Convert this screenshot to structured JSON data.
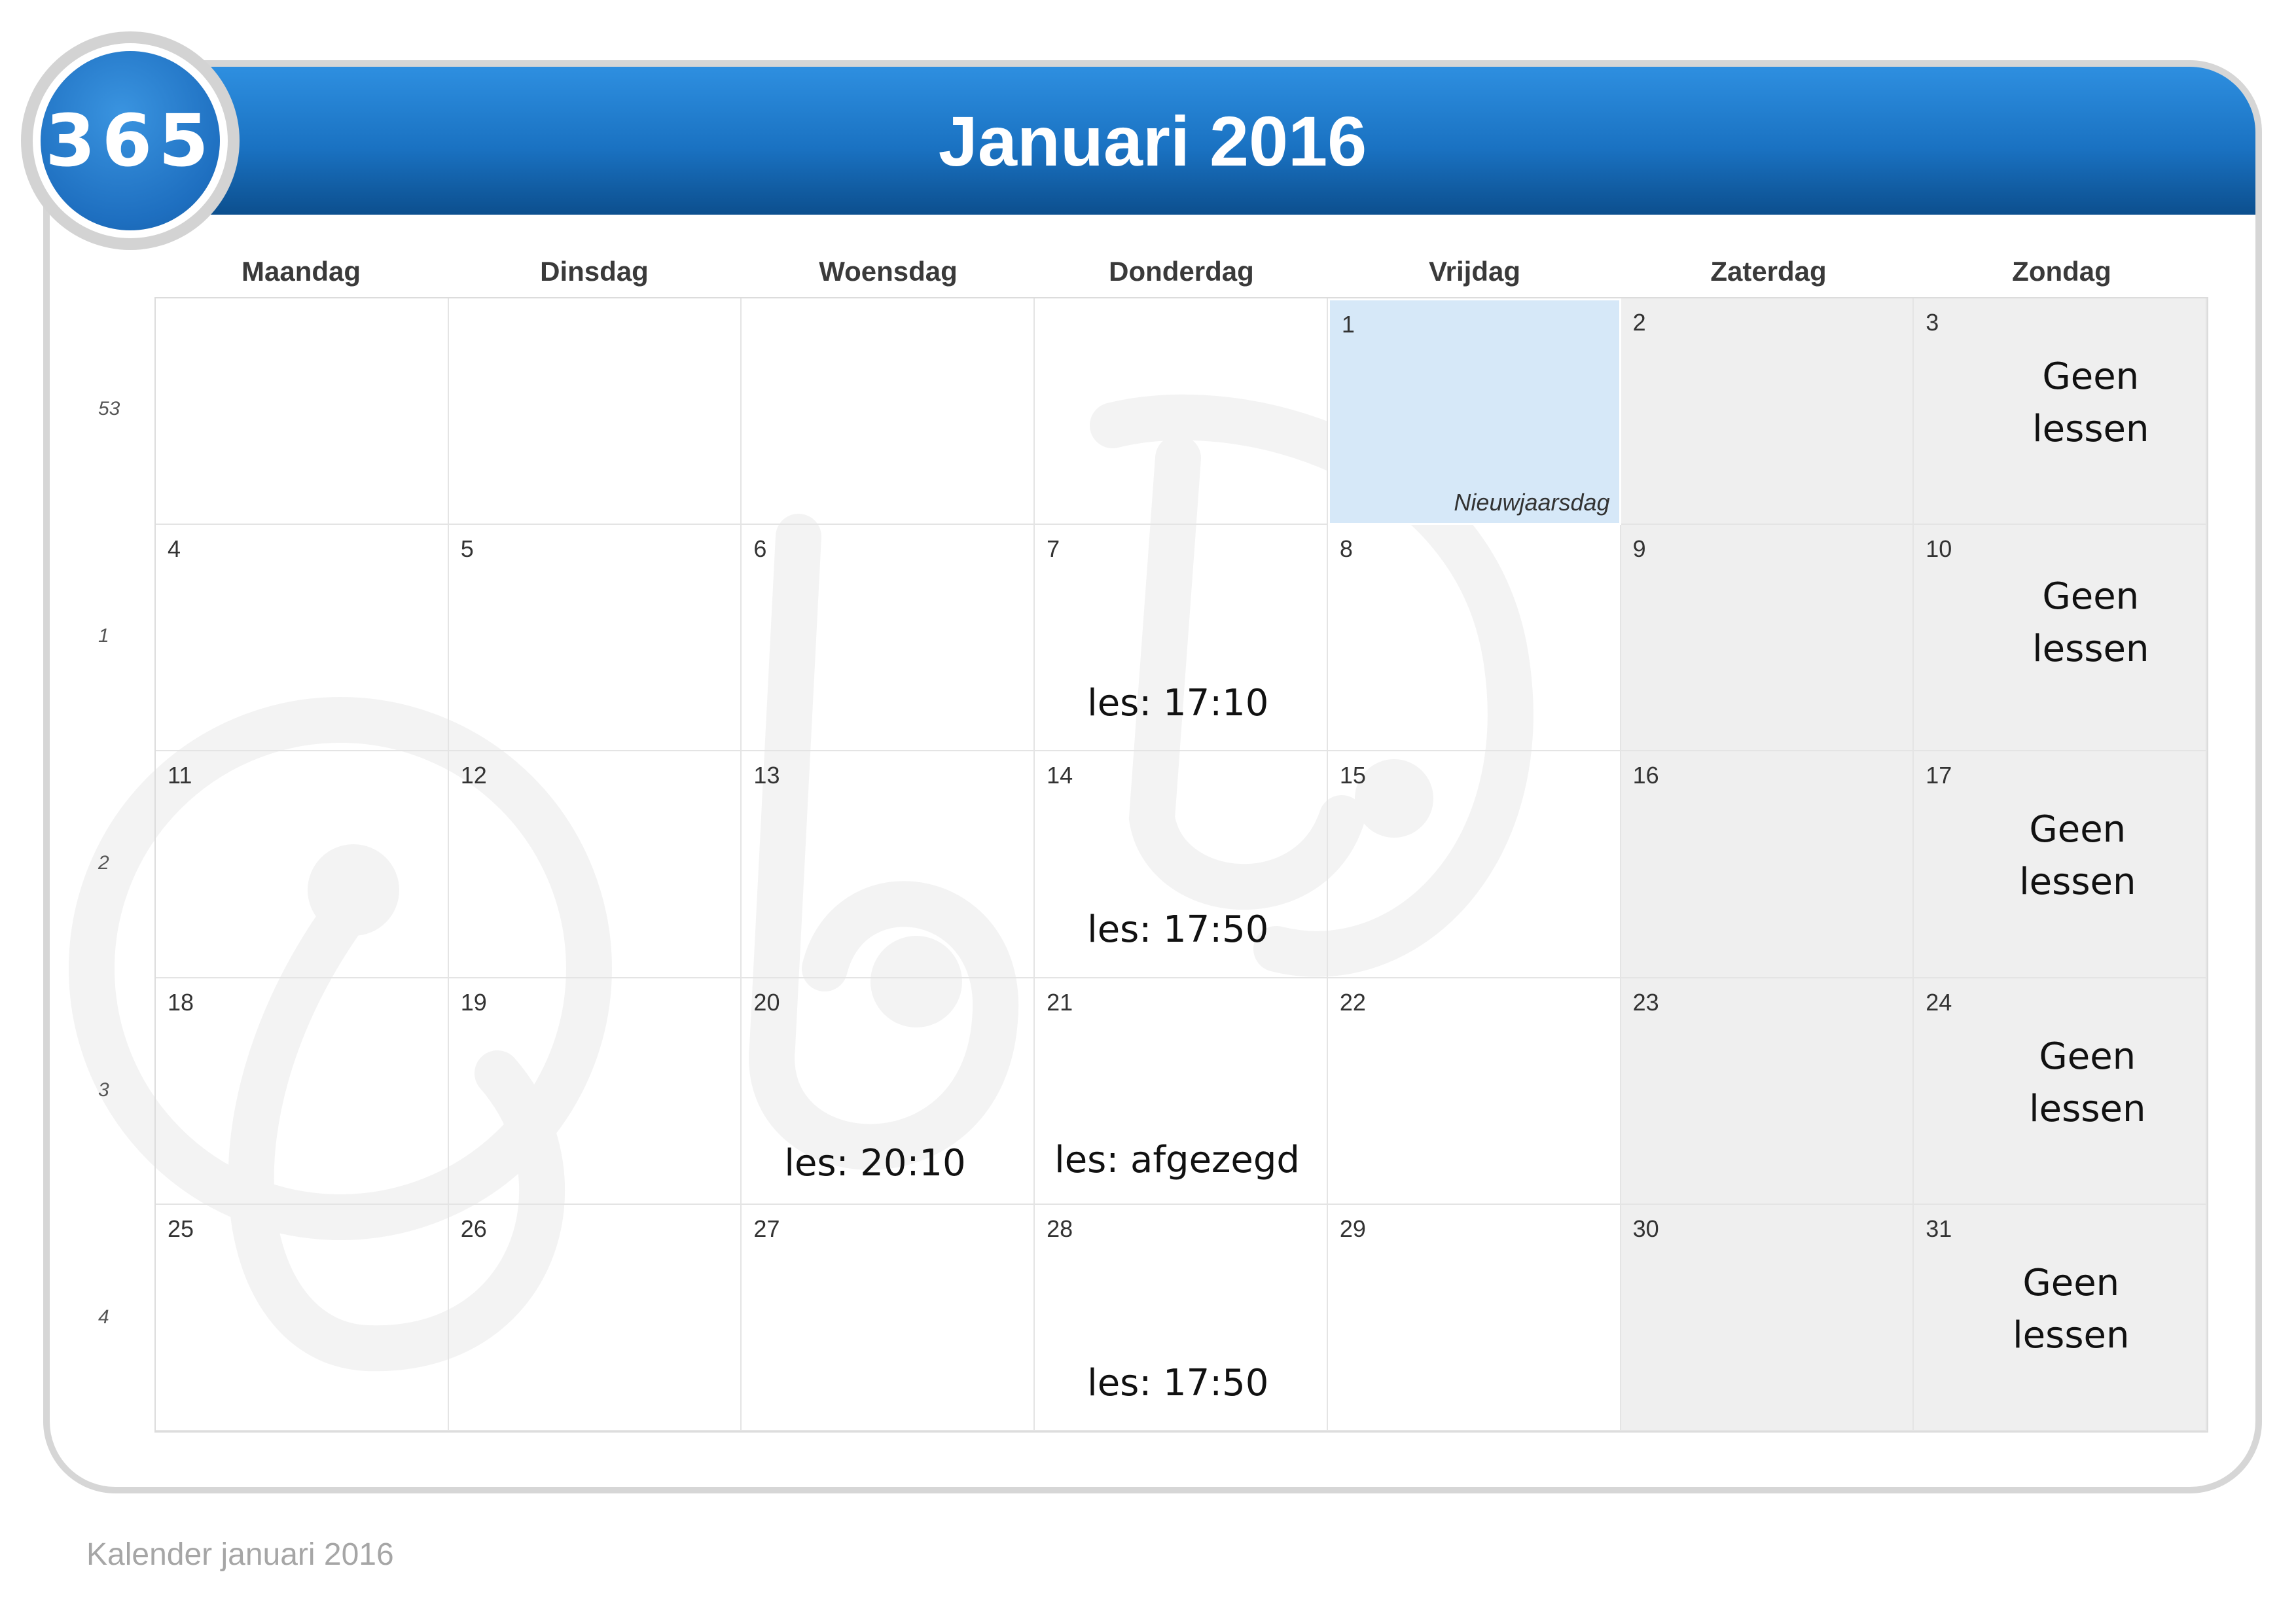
{
  "header": {
    "title": "Januari 2016",
    "logo_text": "365"
  },
  "weekdays": [
    "Maandag",
    "Dinsdag",
    "Woensdag",
    "Donderdag",
    "Vrijdag",
    "Zaterdag",
    "Zondag"
  ],
  "weeks": [
    "53",
    "1",
    "2",
    "3",
    "4"
  ],
  "days": [
    "",
    "",
    "",
    "",
    "1",
    "2",
    "3",
    "4",
    "5",
    "6",
    "7",
    "8",
    "9",
    "10",
    "11",
    "12",
    "13",
    "14",
    "15",
    "16",
    "17",
    "18",
    "19",
    "20",
    "21",
    "22",
    "23",
    "24",
    "25",
    "26",
    "27",
    "28",
    "29",
    "30",
    "31"
  ],
  "holiday": {
    "label": "Nieuwjaarsdag"
  },
  "notes": {
    "geen_line1": "Geen",
    "geen_line2": "lessen",
    "jan7": "les: 17:10",
    "jan14": "les: 17:50",
    "jan20": "les: 20:10",
    "jan21": "les: afgezegd",
    "jan28": "les: 17:50"
  },
  "footer": "Kalender januari 2016",
  "colors": {
    "header_blue": "#1a72c2",
    "holiday_blue": "#d6e8f8",
    "weekend_gray": "#ececec"
  }
}
